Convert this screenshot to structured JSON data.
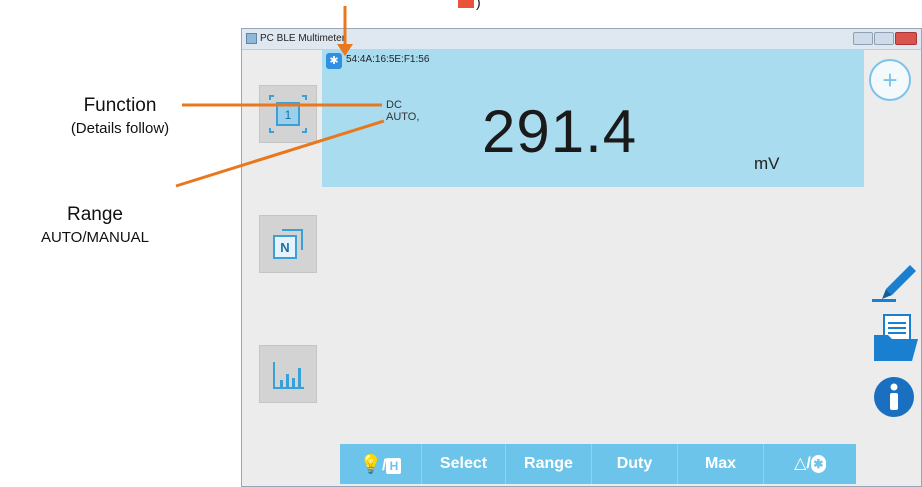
{
  "annotations": {
    "function_title": "Function",
    "function_sub": "(Details follow)",
    "range_title": "Range",
    "range_sub": "AUTO/MANUAL",
    "top_fragment": ")"
  },
  "window": {
    "title": "PC BLE Multimeter"
  },
  "display": {
    "device_address": "54:4A:16:5E:F1:56",
    "function": "DC",
    "range": "AUTO,",
    "reading": "291.4",
    "unit": "mV"
  },
  "toolbar": {
    "light_hold_slash": "/",
    "light_hold_h": "H",
    "select": "Select",
    "range": "Range",
    "duty": "Duty",
    "max": "Max",
    "rel_bt_slash": "/"
  },
  "colors": {
    "display_bg": "#a9dcef",
    "toolbar_bg": "#6cc4ea",
    "annotation_line": "#e8781e",
    "accent_blue": "#2f8fe0"
  },
  "icons": {
    "left_buttons": [
      "frame-1-icon",
      "n-icon",
      "bar-chart-icon"
    ],
    "right_buttons": [
      "add-icon",
      "pen-icon",
      "folder-icon",
      "info-icon"
    ]
  }
}
